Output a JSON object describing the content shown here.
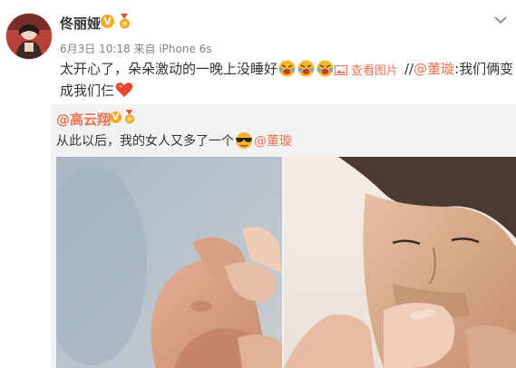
{
  "post": {
    "author": "佟丽娅",
    "verified_mark": "V",
    "date": "6月3日 10:18",
    "via_label": "来自",
    "device": "iPhone 6s",
    "text_line1": "太开心了，朵朵激动的一晚上没睡好",
    "view_pictures": "查看图片",
    "separator": "//",
    "mention": "@董璇",
    "mention_colon_text": ":我们俩变",
    "text_line2": "成我们仨"
  },
  "repost": {
    "author": "@高云翔",
    "verified_mark": "V",
    "text": "从此以后，我的女人又多了一个",
    "mention": "@董璇"
  },
  "colors": {
    "accent": "#eb7350",
    "verified": "#f6a723",
    "repost_bg": "#f2f2f5",
    "meta_text": "#808080"
  },
  "icons": {
    "chevron": "chevron-down-icon",
    "medal": "medal-icon",
    "emoji": "laughing-crying-emoji",
    "heart": "heart-icon",
    "sunglasses": "sunglasses-emoji",
    "picture": "picture-icon"
  }
}
